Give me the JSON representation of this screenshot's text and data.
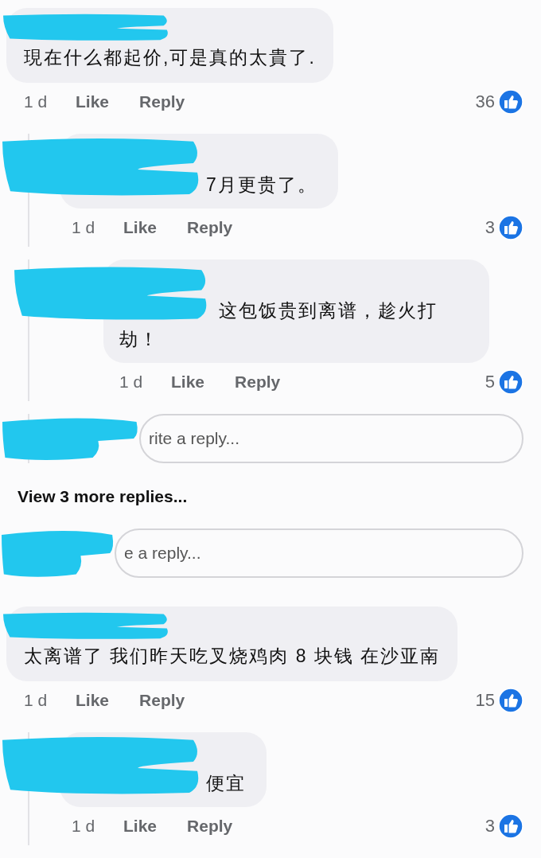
{
  "items": [
    {
      "kind": "comment",
      "text": "現在什么都起价,可是真的太貴了.",
      "time": "1 d",
      "like": "Like",
      "reply": "Reply",
      "count": "36",
      "children": [
        {
          "kind": "comment",
          "text": "7月更贵了。",
          "time": "1 d",
          "like": "Like",
          "reply": "Reply",
          "count": "3",
          "children": [
            {
              "kind": "comment",
              "text": "这包饭贵到离谱，趁火打劫！",
              "time": "1 d",
              "like": "Like",
              "reply": "Reply",
              "count": "5"
            },
            {
              "kind": "reply_field",
              "placeholder": "rite a reply..."
            }
          ]
        }
      ]
    },
    {
      "kind": "view_more",
      "label": "View 3 more replies..."
    },
    {
      "kind": "reply_field",
      "placeholder": "e a reply..."
    },
    {
      "kind": "comment",
      "text": "太离谱了 我们昨天吃叉烧鸡肉 8 块钱 在沙亚南",
      "time": "1 d",
      "like": "Like",
      "reply": "Reply",
      "count": "15",
      "children": [
        {
          "kind": "comment",
          "text": "便宜",
          "time": "1 d",
          "like": "Like",
          "reply": "Reply",
          "count": "3"
        }
      ]
    }
  ]
}
